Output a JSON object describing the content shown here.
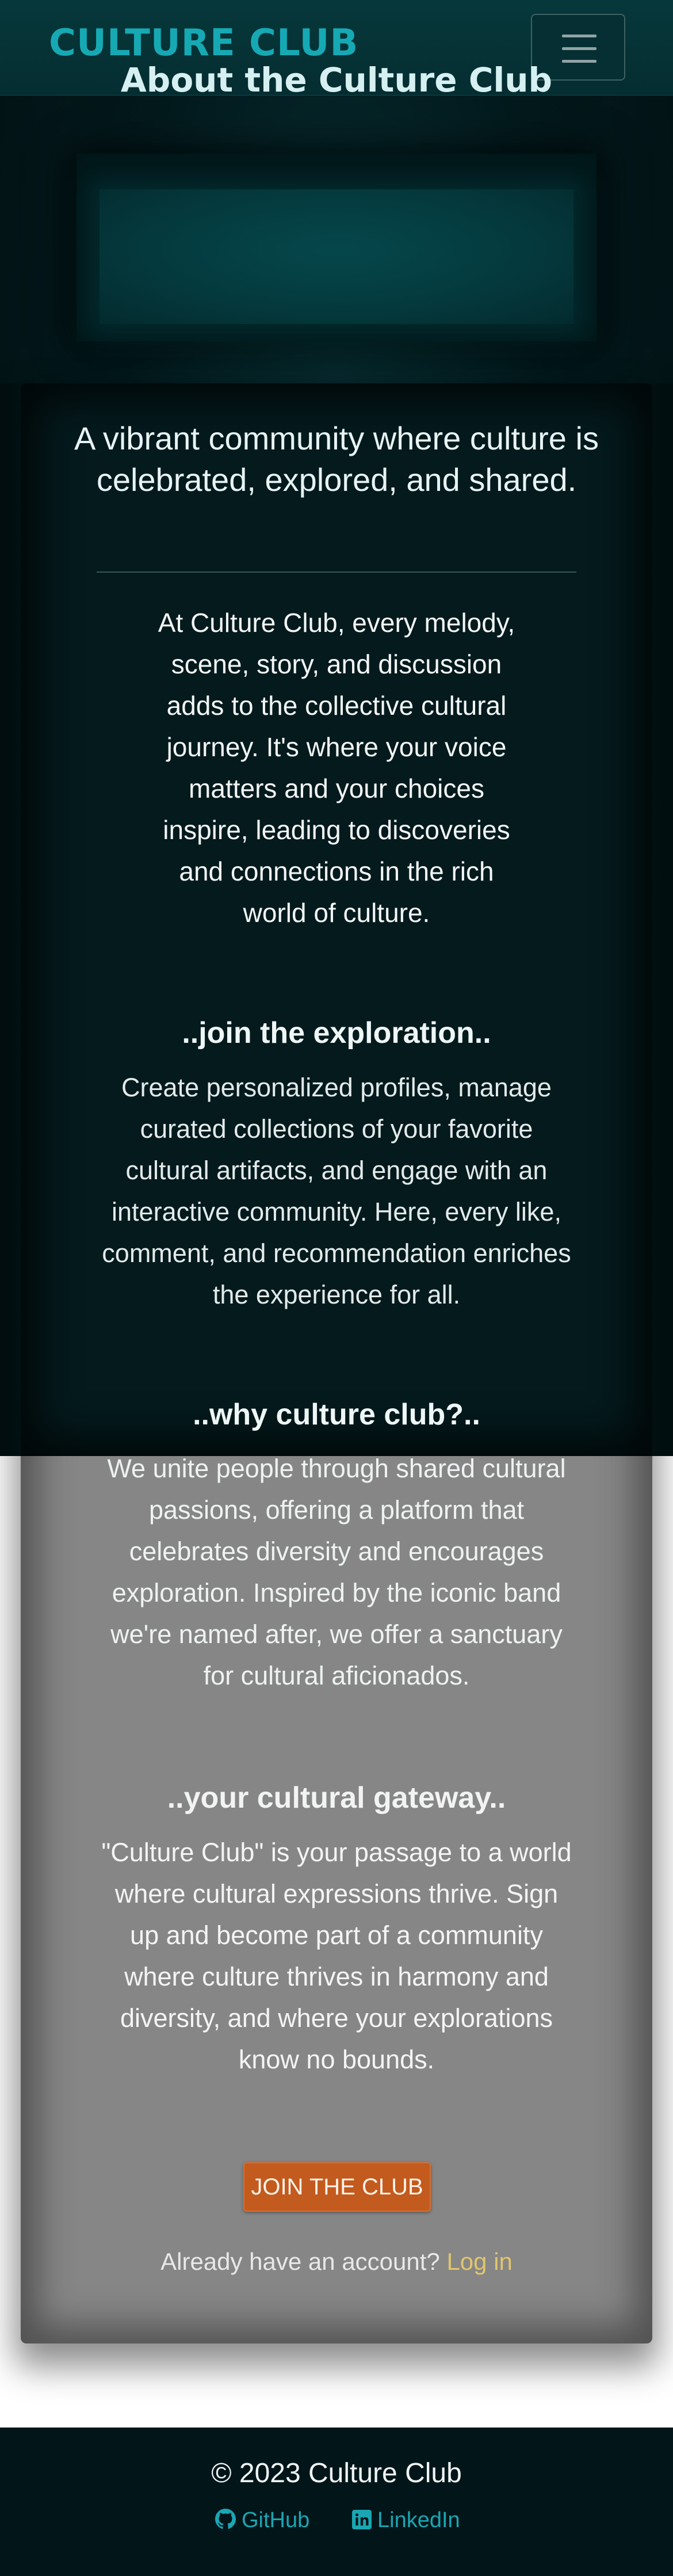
{
  "navbar": {
    "brand": "CULTURE CLUB",
    "toggler_icon": "hamburger-menu-icon"
  },
  "hero": {
    "title": "About the Culture Club"
  },
  "main": {
    "lead": "A vibrant community where culture is celebrated, explored, and shared.",
    "intro": "At Culture Club, every melody, scene, story, and discussion adds to the collective cultural journey. It's where your voice matters and your choices inspire, leading to discoveries and connections in the rich world of culture.",
    "sections": [
      {
        "heading": "..join the exploration..",
        "body": "Create personalized profiles, manage curated collections of your favorite cultural artifacts, and engage with an interactive community. Here, every like, comment, and recommendation enriches the experience for all."
      },
      {
        "heading": "..why culture club?..",
        "body": "We unite people through shared cultural passions, offering a platform that celebrates diversity and encourages exploration. Inspired by the iconic band we're named after, we offer a sanctuary for cultural aficionados."
      },
      {
        "heading": "..your cultural gateway..",
        "body": "\"Culture Club\" is your passage to a world where cultural expressions thrive. Sign up and become part of a community where culture thrives in harmony and diversity, and where your explorations know no bounds."
      }
    ],
    "join_button": "JOIN THE CLUB",
    "login_prompt": "Already have an account?",
    "login_link": "Log in"
  },
  "footer": {
    "copyright": "© 2023 Culture Club",
    "github": "GitHub",
    "linkedin": "LinkedIn",
    "github_icon": "github-icon",
    "linkedin_icon": "linkedin-icon"
  },
  "colors": {
    "brand": "#16a9b4",
    "button": "#c35a1e",
    "link": "#e2c56c",
    "footer_link": "#1aa6b2"
  }
}
